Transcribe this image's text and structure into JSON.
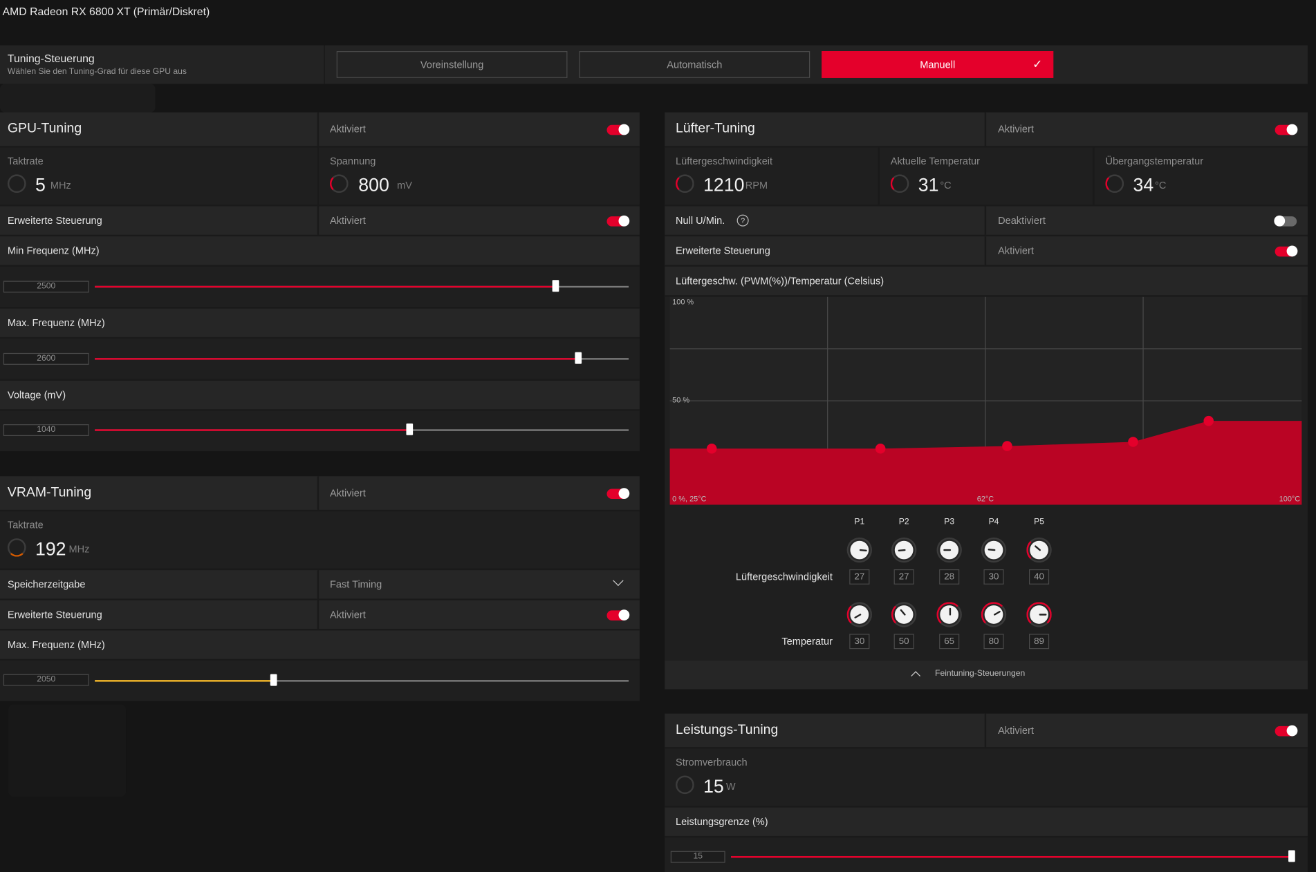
{
  "window_title": "AMD Radeon RX 6800 XT (Primär/Diskret)",
  "tuning_control": {
    "label": "Tuning-Steuerung",
    "sublabel": "Wählen Sie den Tuning-Grad für diese GPU aus",
    "options": [
      "Voreinstellung",
      "Automatisch",
      "Manuell"
    ],
    "selected": "Manuell"
  },
  "gpu_tuning": {
    "title": "GPU-Tuning",
    "status": "Aktiviert",
    "clock_label": "Taktrate",
    "clock_value": "5",
    "clock_unit": "MHz",
    "voltage_label": "Spannung",
    "voltage_value": "800",
    "voltage_unit": "mV",
    "advanced_label": "Erweiterte Steuerung",
    "advanced_status": "Aktiviert",
    "min_freq_label": "Min Frequenz (MHz)",
    "min_freq_value": "2500",
    "min_freq_fraction": 0.863,
    "max_freq_label": "Max. Frequenz (MHz)",
    "max_freq_value": "2600",
    "max_freq_fraction": 0.906,
    "voltage_slider_label": "Voltage (mV)",
    "voltage_slider_value": "1040",
    "voltage_slider_fraction": 0.59
  },
  "vram_tuning": {
    "title": "VRAM-Tuning",
    "status": "Aktiviert",
    "clock_label": "Taktrate",
    "clock_value": "192",
    "clock_unit": "MHz",
    "memory_timing_label": "Speicherzeitgabe",
    "memory_timing_value": "Fast Timing",
    "advanced_label": "Erweiterte Steuerung",
    "advanced_status": "Aktiviert",
    "max_freq_label": "Max. Frequenz (MHz)",
    "max_freq_value": "2050",
    "max_freq_fraction": 0.335
  },
  "fan_tuning": {
    "title": "Lüfter-Tuning",
    "status": "Aktiviert",
    "fan_speed_label": "Lüftergeschwindigkeit",
    "fan_speed_value": "1210",
    "fan_speed_unit": "RPM",
    "current_temp_label": "Aktuelle Temperatur",
    "current_temp_value": "31",
    "current_temp_unit": "°C",
    "junction_temp_label": "Übergangstemperatur",
    "junction_temp_value": "34",
    "junction_temp_unit": "°C",
    "zero_rpm_label": "Null U/Min.",
    "zero_rpm_status": "Deaktiviert",
    "advanced_label": "Erweiterte Steuerung",
    "advanced_status": "Aktiviert",
    "curve_title": "Lüftergeschw. (PWM(%))/Temperatur (Celsius)",
    "curve_labels": {
      "y_top": "100 %",
      "y_mid": "50 %",
      "origin": "0 %, 25°C",
      "x_mid": "62°C",
      "x_max": "100°C"
    },
    "points_header": [
      "P1",
      "P2",
      "P3",
      "P4",
      "P5"
    ],
    "speed_row_label": "Lüftergeschwindigkeit",
    "speeds": [
      "27",
      "27",
      "28",
      "30",
      "40"
    ],
    "temp_row_label": "Temperatur",
    "temps": [
      "30",
      "50",
      "65",
      "80",
      "89"
    ],
    "fine_tuning_label": "Feintuning-Steuerungen"
  },
  "power_tuning": {
    "title": "Leistungs-Tuning",
    "status": "Aktiviert",
    "power_label": "Stromverbrauch",
    "power_value": "15",
    "power_unit": "W",
    "limit_label": "Leistungsgrenze (%)",
    "limit_value": "15",
    "limit_fraction": 1.0
  },
  "colors": {
    "accent": "#e4002b",
    "vram_slider": "#f0b323",
    "panel": "#262626",
    "background": "#151515"
  }
}
